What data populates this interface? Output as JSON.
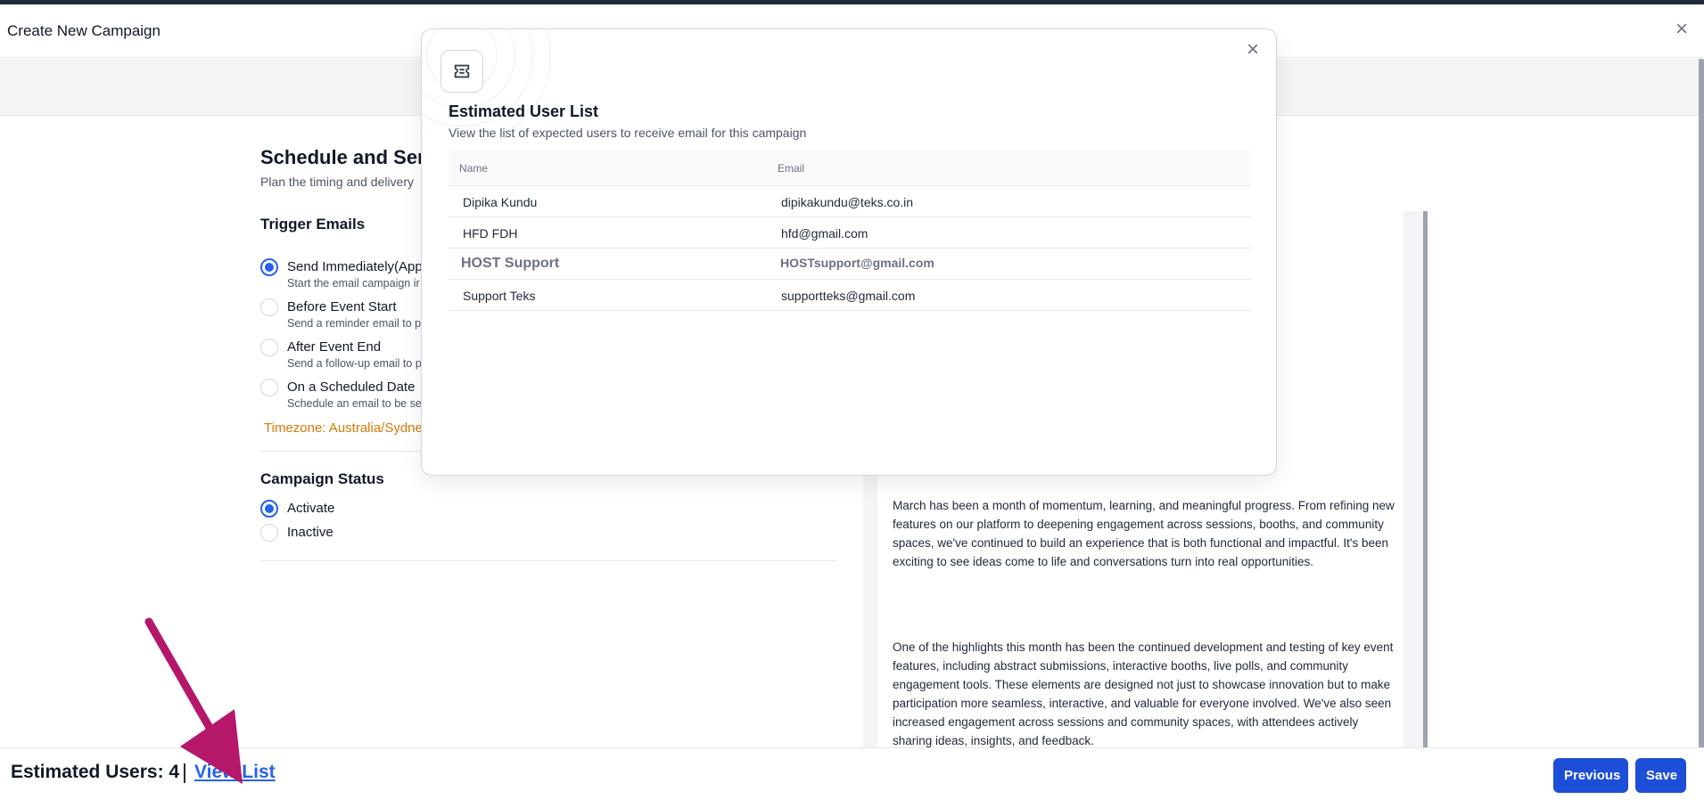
{
  "header": {
    "title": "Create New Campaign",
    "close_symbol": "×"
  },
  "form": {
    "section_title": "Schedule and Ser",
    "section_subtitle": "Plan the timing and delivery",
    "trigger_title": "Trigger Emails",
    "trigger_options": [
      {
        "label": "Send Immediately(App",
        "desc": "Start the email campaign ir",
        "checked": true
      },
      {
        "label": "Before Event Start",
        "desc": "Send a reminder email to p",
        "checked": false
      },
      {
        "label": "After Event End",
        "desc": "Send a follow-up email to p",
        "checked": false
      },
      {
        "label": "On a Scheduled Date",
        "desc": "Schedule an email to be se",
        "checked": false
      }
    ],
    "timezone": "Timezone: Australia/Sydne",
    "status_title": "Campaign Status",
    "status_options": [
      {
        "label": "Activate",
        "checked": true
      },
      {
        "label": "Inactive",
        "checked": false
      }
    ]
  },
  "preview": {
    "paragraph1": "March has been a month of momentum, learning, and meaningful progress. From refining new features on our platform to deepening engagement across sessions, booths, and community spaces, we've continued to build an experience that is both functional and impactful. It's been exciting to see ideas come to life and conversations turn into real opportunities.",
    "paragraph2": "One of the highlights this month has been the continued development and testing of key event features, including abstract submissions, interactive booths, live polls, and community engagement tools. These elements are designed not just to showcase innovation but to make participation more seamless, interactive, and valuable for everyone involved. We've also seen increased engagement across sessions and community spaces, with attendees actively sharing ideas, insights, and feedback."
  },
  "footer": {
    "estimated_users": "Estimated Users: 4",
    "separator": "|",
    "view_list": "View List",
    "previous": "Previous",
    "save": "Save"
  },
  "modal": {
    "title": "Estimated User List",
    "subtitle": "View the list of expected users to receive email for this campaign",
    "close_symbol": "×",
    "columns": [
      "Name",
      "Email"
    ],
    "rows": [
      {
        "name": "Dipika Kundu",
        "email": "dipikakundu@teks.co.in"
      },
      {
        "name": "HFD FDH",
        "email": "hfd@gmail.com"
      },
      {
        "name": "HOST Support",
        "email": "HOSTsupport@gmail.com"
      },
      {
        "name": "Support Teks",
        "email": "supportteks@gmail.com"
      }
    ]
  },
  "colors": {
    "accent": "#2563eb",
    "button": "#1d4ed8",
    "timezone": "#d97706",
    "annotation_arrow": "#b5176b"
  },
  "icons": {
    "modal_icon": "ticket-icon",
    "annotation": "arrow-annotation-icon"
  }
}
